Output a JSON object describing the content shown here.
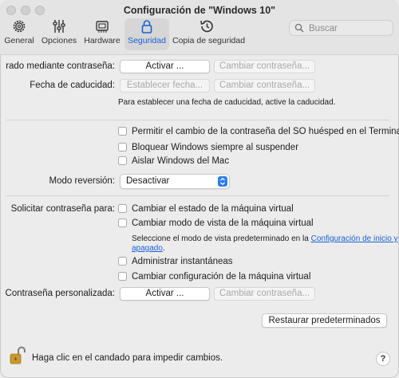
{
  "window": {
    "title": "Configuración de \"Windows 10\""
  },
  "toolbar": {
    "items": [
      {
        "label": "General",
        "icon": "gear-icon"
      },
      {
        "label": "Opciones",
        "icon": "sliders-icon"
      },
      {
        "label": "Hardware",
        "icon": "hardware-chip-icon"
      },
      {
        "label": "Seguridad",
        "icon": "lock-icon",
        "active": true
      },
      {
        "label": "Copia de seguridad",
        "icon": "clock-backup-icon"
      }
    ],
    "search_placeholder": "Buscar"
  },
  "security": {
    "password_row": {
      "label": "rado mediante contraseña:",
      "activate": "Activar ...",
      "change": "Cambiar contraseña..."
    },
    "expiry_row": {
      "label": "Fecha de caducidad:",
      "set_date": "Establecer fecha...",
      "change": "Cambiar contraseña..."
    },
    "expiry_note": "Para establecer una fecha de caducidad, active la caducidad.",
    "checks1": [
      "Permitir el cambio de la contraseña del SO huésped en el Terminal",
      "Bloquear Windows siempre al suspender",
      "Aislar Windows del Mac"
    ],
    "revert": {
      "label": "Modo reversión:",
      "value": "Desactivar"
    },
    "ask_label": "Solicitar contraseña para:",
    "ask_checks": [
      "Cambiar el estado de la máquina virtual",
      "Cambiar modo de vista de la máquina virtual"
    ],
    "view_note_prefix": "Seleccione el modo de vista predeterminado en la ",
    "view_note_link": "Configuración de inicio y",
    "view_note_link2": "apagado",
    "view_note_suffix": ".",
    "ask_checks2": [
      "Administrar instantáneas",
      "Cambiar configuración de la máquina virtual"
    ],
    "custom_row": {
      "label": "Contraseña personalizada:",
      "activate": "Activar ...",
      "change": "Cambiar contraseña..."
    },
    "restore_label": "Restaurar predeterminados"
  },
  "footer": {
    "lock_text": "Haga clic en el candado para impedir cambios.",
    "help": "?"
  },
  "colors": {
    "accent": "#1a5fd6",
    "select_accent": "#2d7bf6"
  }
}
